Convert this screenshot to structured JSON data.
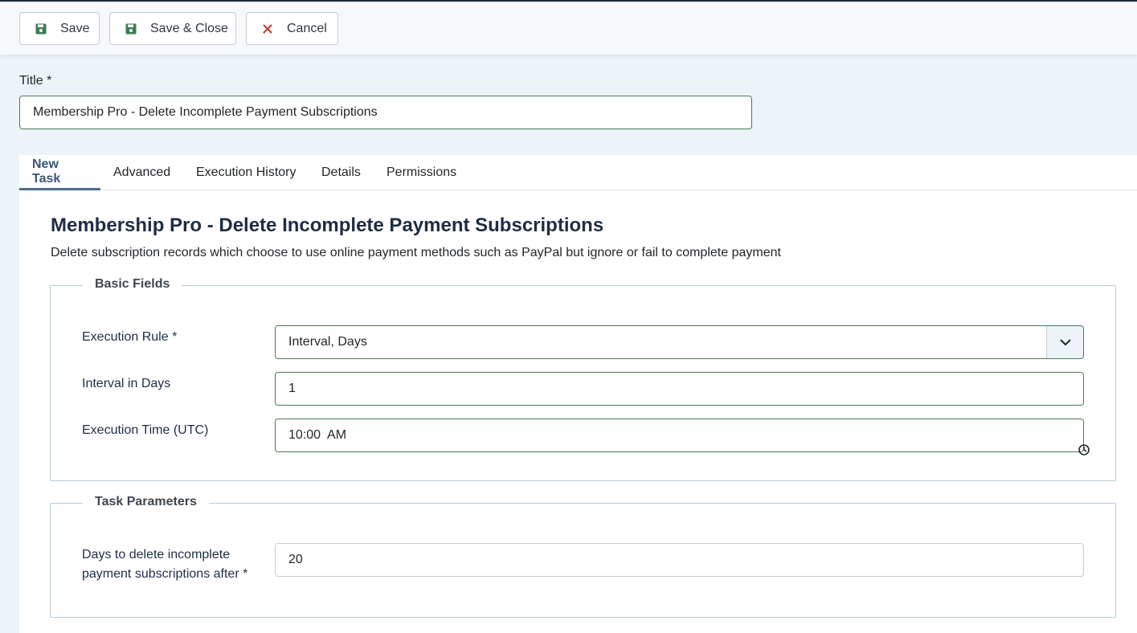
{
  "toolbar": {
    "save_label": "Save",
    "save_close_label": "Save & Close",
    "cancel_label": "Cancel",
    "save_icon": "floppy-disk-icon",
    "cancel_icon": "close-icon",
    "save_icon_color": "#3a7d4e",
    "cancel_icon_color": "#c0392b"
  },
  "title_field": {
    "label": "Title *",
    "value": "Membership Pro - Delete Incomplete Payment Subscriptions"
  },
  "tabs": [
    {
      "label": "New Task",
      "active": true
    },
    {
      "label": "Advanced",
      "active": false
    },
    {
      "label": "Execution History",
      "active": false
    },
    {
      "label": "Details",
      "active": false
    },
    {
      "label": "Permissions",
      "active": false
    }
  ],
  "task": {
    "title": "Membership Pro - Delete Incomplete Payment Subscriptions",
    "description": "Delete subscription records which choose to use online payment methods such as PayPal but ignore or fail to complete payment"
  },
  "basic_fields": {
    "legend": "Basic Fields",
    "execution_rule": {
      "label": "Execution Rule *",
      "value": "Interval, Days"
    },
    "interval_days": {
      "label": "Interval in Days",
      "value": "1"
    },
    "execution_time": {
      "label": "Execution Time (UTC)",
      "value": "10:00  AM"
    }
  },
  "task_parameters": {
    "legend": "Task Parameters",
    "days_delete": {
      "label_line1": "Days to delete incomplete",
      "label_line2": "payment subscriptions after *",
      "value": "20"
    }
  }
}
